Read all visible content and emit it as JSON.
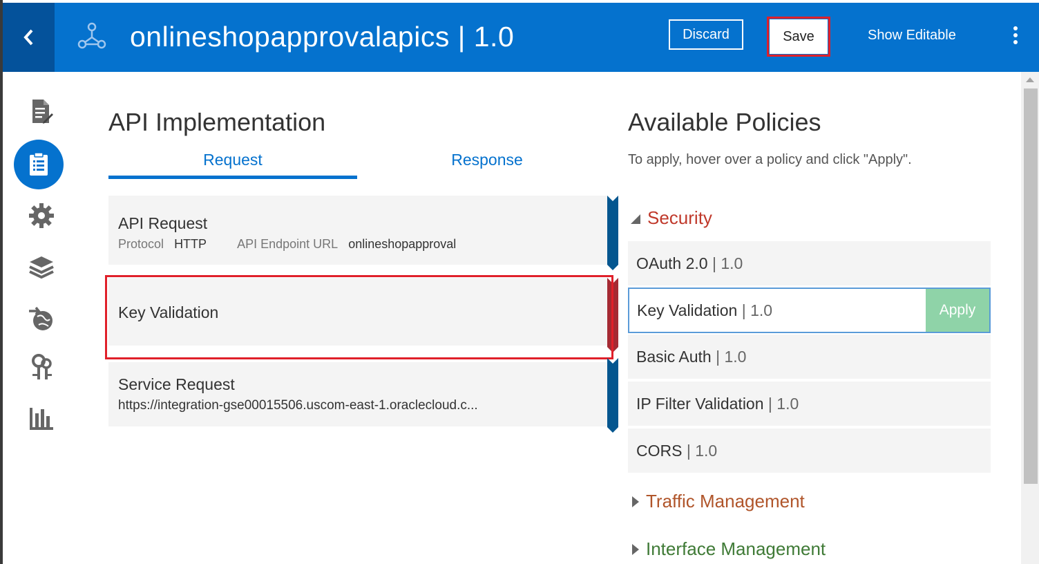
{
  "header": {
    "title": "onlineshopapprovalapics | 1.0",
    "discard_label": "Discard",
    "save_label": "Save",
    "show_editable_label": "Show Editable"
  },
  "nav": {
    "items": [
      "document-edit-icon",
      "api-implementation-icon",
      "gear-icon",
      "layers-icon",
      "globe-deploy-icon",
      "keys-icon",
      "analytics-icon"
    ],
    "active": "api-implementation-icon"
  },
  "implementation": {
    "title": "API Implementation",
    "tabs": [
      {
        "label": "Request",
        "active": true
      },
      {
        "label": "Response",
        "active": false
      }
    ],
    "api_request": {
      "title": "API Request",
      "protocol_label": "Protocol",
      "protocol_value": "HTTP",
      "endpoint_label": "API Endpoint URL",
      "endpoint_value": "onlineshopapproval"
    },
    "key_validation": {
      "title": "Key Validation"
    },
    "service_request": {
      "title": "Service Request",
      "url": "https://integration-gse00015506.uscom-east-1.oraclecloud.c..."
    }
  },
  "policies": {
    "title": "Available Policies",
    "description": "To apply, hover over a policy and click \"Apply\".",
    "apply_label": "Apply",
    "categories": [
      {
        "name": "Security",
        "expanded": true,
        "color": "#c0392b",
        "items": [
          {
            "name": "OAuth 2.0",
            "version": "| 1.0"
          },
          {
            "name": "Key Validation",
            "version": "| 1.0"
          },
          {
            "name": "Basic Auth",
            "version": "| 1.0"
          },
          {
            "name": "IP Filter Validation",
            "version": "| 1.0"
          },
          {
            "name": "CORS",
            "version": "| 1.0"
          }
        ]
      },
      {
        "name": "Traffic Management",
        "expanded": false,
        "color": "#b0552a"
      },
      {
        "name": "Interface Management",
        "expanded": false,
        "color": "#3f7a36"
      }
    ]
  },
  "colors": {
    "header": "#0572ce",
    "header_dark": "#04529b",
    "highlight": "#e0202a",
    "apply": "#8fd3a8",
    "flow_bar": "#04568f"
  }
}
